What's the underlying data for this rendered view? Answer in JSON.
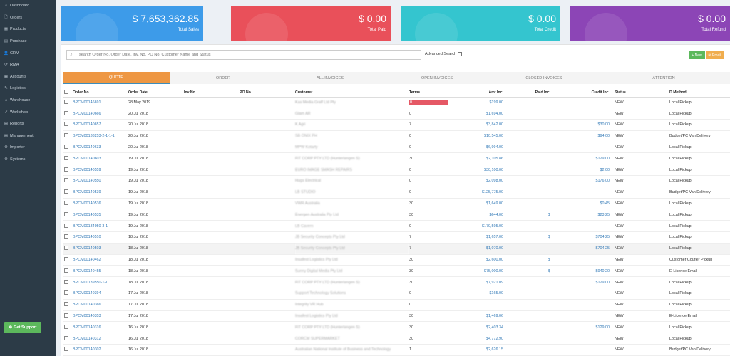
{
  "sidebar": {
    "items": [
      {
        "icon": "⌂",
        "label": "Dashboard"
      },
      {
        "icon": "🗋",
        "label": "Orders"
      },
      {
        "icon": "▦",
        "label": "Products"
      },
      {
        "icon": "▤",
        "label": "Purchase"
      },
      {
        "icon": "👤",
        "label": "CRM"
      },
      {
        "icon": "⟳",
        "label": "RMA"
      },
      {
        "icon": "▦",
        "label": "Accounts"
      },
      {
        "icon": "✎",
        "label": "Logistics"
      },
      {
        "icon": "⌂",
        "label": "Warehouse"
      },
      {
        "icon": "✔",
        "label": "Workshop"
      },
      {
        "icon": "▤",
        "label": "Reports"
      },
      {
        "icon": "▤",
        "label": "Management"
      },
      {
        "icon": "⚙",
        "label": "Importer"
      },
      {
        "icon": "⚙",
        "label": "Systems"
      }
    ],
    "support_label": "Get Support"
  },
  "cards": [
    {
      "value": "$ 7,653,362.85",
      "label": "Total Sales",
      "color": "#3d9be9"
    },
    {
      "value": "$ 0.00",
      "label": "Total Paid",
      "color": "#e9505a"
    },
    {
      "value": "$ 0.00",
      "label": "Total Credit",
      "color": "#34c5cf"
    },
    {
      "value": "$ 0.00",
      "label": "Total Refund",
      "color": "#8c45b6"
    }
  ],
  "search": {
    "placeholder": "search Order No, Order Date, Inv. No, PO No, Customer Name and Status",
    "advanced_label": "Advanced Search"
  },
  "buttons": {
    "new": "+ New",
    "email": "✉ Email"
  },
  "tabs": [
    "QUOTE",
    "ORDER",
    "ALL INVOICES",
    "OPEN INVOICES",
    "CLOSED INVOICES",
    "ATTENTION"
  ],
  "columns": [
    "Order No",
    "Order Date",
    "Inv No",
    "PO No",
    "Customer",
    "Terms",
    "Amt Inc.",
    "Paid Inc.",
    "Credit Inc.",
    "Status",
    "D.Method"
  ],
  "rows": [
    {
      "order": "BPCM00146691",
      "date": "28 May 2019",
      "customer": "Kas Media Graff Ltd Pty",
      "terms": "0",
      "amt": "$199.00",
      "paid": "",
      "credit": "",
      "status": "NEW",
      "method": "Local Pickup"
    },
    {
      "order": "BPCM00140666",
      "date": "20 Jul 2018",
      "customer": "Glam AR",
      "terms": "0",
      "amt": "$1,694.00",
      "paid": "",
      "credit": "",
      "status": "NEW",
      "method": "Local Pickup"
    },
    {
      "order": "BPCM00140657",
      "date": "20 Jul 2018",
      "customer": "K Agri",
      "terms": "7",
      "amt": "$3,842.00",
      "paid": "",
      "credit": "$30.00",
      "status": "NEW",
      "method": "Local Pickup"
    },
    {
      "order": "BPCM00138253-2-1-1-1",
      "date": "20 Jul 2018",
      "customer": "SB ONIX PH",
      "terms": "0",
      "amt": "$10,545.00",
      "paid": "",
      "credit": "$94.00",
      "status": "NEW",
      "method": "Budget/PC Van Delivery"
    },
    {
      "order": "BPCM00140633",
      "date": "20 Jul 2018",
      "customer": "MPW Kotarty",
      "terms": "0",
      "amt": "$6,994.00",
      "paid": "",
      "credit": "",
      "status": "NEW",
      "method": "Local Pickup"
    },
    {
      "order": "BPCM00140603",
      "date": "19 Jul 2018",
      "customer": "FIT CORP PTY LTD (Hunterlangen S)",
      "terms": "30",
      "amt": "$2,105.86",
      "paid": "",
      "credit": "$129.00",
      "status": "NEW",
      "method": "Local Pickup"
    },
    {
      "order": "BPCM00140559",
      "date": "19 Jul 2018",
      "customer": "EURO IMAGE SMASH REPAIRS",
      "terms": "0",
      "amt": "$30,100.00",
      "paid": "",
      "credit": "$2.00",
      "status": "NEW",
      "method": "Local Pickup"
    },
    {
      "order": "BPCM00140550",
      "date": "19 Jul 2018",
      "customer": "Hugs Electrical",
      "terms": "0",
      "amt": "$2,098.00",
      "paid": "",
      "credit": "$176.00",
      "status": "NEW",
      "method": "Local Pickup"
    },
    {
      "order": "BPCM00140539",
      "date": "19 Jul 2018",
      "customer": "LB STUDIO",
      "terms": "0",
      "amt": "$125,775.00",
      "paid": "",
      "credit": "",
      "status": "NEW",
      "method": "Budget/PC Van Delivery"
    },
    {
      "order": "BPCM00140536",
      "date": "19 Jul 2018",
      "customer": "VWR Australia",
      "terms": "30",
      "amt": "$1,649.00",
      "paid": "",
      "credit": "$0.45",
      "status": "NEW",
      "method": "Local Pickup"
    },
    {
      "order": "BPCM00140535",
      "date": "19 Jul 2018",
      "customer": "Energen Australia Pty Ltd",
      "terms": "30",
      "amt": "$644.00",
      "paid": "$",
      "credit": "$23.25",
      "status": "NEW",
      "method": "Local Pickup"
    },
    {
      "order": "BPCM00134950-3-1",
      "date": "19 Jul 2018",
      "customer": "LB Cavern",
      "terms": "0",
      "amt": "$179,595.00",
      "paid": "",
      "credit": "",
      "status": "NEW",
      "method": "Local Pickup"
    },
    {
      "order": "BPCM00140510",
      "date": "18 Jul 2018",
      "customer": "JB Security Concepts Pty Ltd",
      "terms": "7",
      "amt": "$1,657.00",
      "paid": "$",
      "credit": "$704.25",
      "status": "NEW",
      "method": "Local Pickup"
    },
    {
      "order": "BPCM00140503",
      "date": "18 Jul 2018",
      "customer": "JB Security Concepts Pty Ltd",
      "terms": "7",
      "amt": "$1,070.00",
      "paid": "",
      "credit": "$704.25",
      "status": "NEW",
      "method": "Local Pickup"
    },
    {
      "order": "BPCM00140462",
      "date": "18 Jul 2018",
      "customer": "Insafest Logistics Pty Ltd",
      "terms": "30",
      "amt": "$2,600.00",
      "paid": "$",
      "credit": "",
      "status": "NEW",
      "method": "Customer Courier Pickup"
    },
    {
      "order": "BPCM00140455",
      "date": "18 Jul 2018",
      "customer": "Sunny Digital Media Pty Ltd",
      "terms": "30",
      "amt": "$75,000.00",
      "paid": "$",
      "credit": "$940.20",
      "status": "NEW",
      "method": "E-Licence Email"
    },
    {
      "order": "BPCM00139550-1-1",
      "date": "18 Jul 2018",
      "customer": "FIT CORP PTY LTD (Hunterlangen S)",
      "terms": "30",
      "amt": "$7,921.09",
      "paid": "",
      "credit": "$129.00",
      "status": "NEW",
      "method": "Local Pickup"
    },
    {
      "order": "BPCM00140394",
      "date": "17 Jul 2018",
      "customer": "Support Technology Solutions",
      "terms": "0",
      "amt": "$165.00",
      "paid": "",
      "credit": "",
      "status": "NEW",
      "method": "Local Pickup"
    },
    {
      "order": "BPCM00140366",
      "date": "17 Jul 2018",
      "customer": "Integrity VR Hub",
      "terms": "0",
      "amt": "",
      "paid": "",
      "credit": "",
      "status": "NEW",
      "method": "Local Pickup"
    },
    {
      "order": "BPCM00140353",
      "date": "17 Jul 2018",
      "customer": "Insafest Logistics Pty Ltd",
      "terms": "30",
      "amt": "$1,469.06",
      "paid": "",
      "credit": "",
      "status": "NEW",
      "method": "E-Licence Email"
    },
    {
      "order": "BPCM00140316",
      "date": "16 Jul 2018",
      "customer": "FIT CORP PTY LTD (Hunterlangen S)",
      "terms": "30",
      "amt": "$2,403.34",
      "paid": "",
      "credit": "$129.00",
      "status": "NEW",
      "method": "Local Pickup"
    },
    {
      "order": "BPCM00140312",
      "date": "16 Jul 2018",
      "customer": "CORCM SUPERMARKET",
      "terms": "30",
      "amt": "$4,772.90",
      "paid": "",
      "credit": "",
      "status": "NEW",
      "method": "Local Pickup"
    },
    {
      "order": "BPCM00140302",
      "date": "16 Jul 2018",
      "customer": "Australian National Institute of Business and Technology",
      "terms": "1",
      "amt": "$2,626.15",
      "paid": "",
      "credit": "",
      "status": "NEW",
      "method": "Budget/PC Van Delivery"
    }
  ]
}
